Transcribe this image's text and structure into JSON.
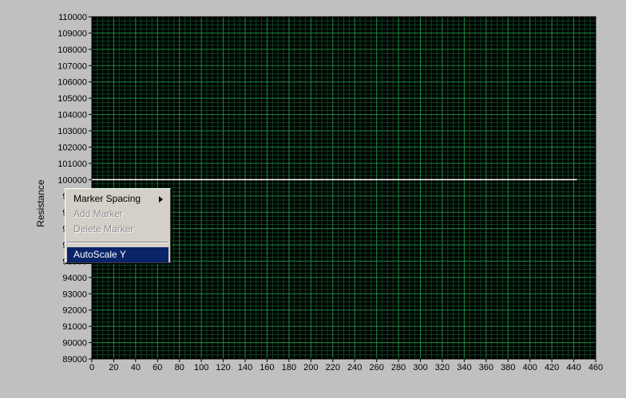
{
  "context_menu": {
    "items": [
      {
        "label": "Marker Spacing",
        "has_submenu": true,
        "enabled": true
      },
      {
        "label": "Add Marker",
        "enabled": false
      },
      {
        "label": "Delete Marker",
        "enabled": false
      },
      {
        "label": "AutoScale Y",
        "enabled": true,
        "highlighted": true
      }
    ]
  },
  "chart_data": {
    "type": "line",
    "title": "",
    "xlabel": "",
    "ylabel": "Resistance",
    "xlim": [
      0,
      460
    ],
    "ylim": [
      89000,
      110000
    ],
    "x_ticks": [
      0,
      20,
      40,
      60,
      80,
      100,
      120,
      140,
      160,
      180,
      200,
      220,
      240,
      260,
      280,
      300,
      320,
      340,
      360,
      380,
      400,
      420,
      440,
      460
    ],
    "y_ticks": [
      89000,
      90000,
      91000,
      92000,
      93000,
      94000,
      95000,
      96000,
      97000,
      98000,
      99000,
      100000,
      101000,
      102000,
      103000,
      104000,
      105000,
      106000,
      107000,
      108000,
      109000,
      110000
    ],
    "grid": true,
    "minor_divisions": 4,
    "series": [
      {
        "x": [
          0,
          443
        ],
        "y": [
          100000,
          100000
        ],
        "color": "#ffffff"
      }
    ],
    "colors": {
      "plot_background": "#000000",
      "major_grid": "#1f8a45",
      "minor_grid": "#0d4420",
      "axis_text": "#000000"
    }
  }
}
